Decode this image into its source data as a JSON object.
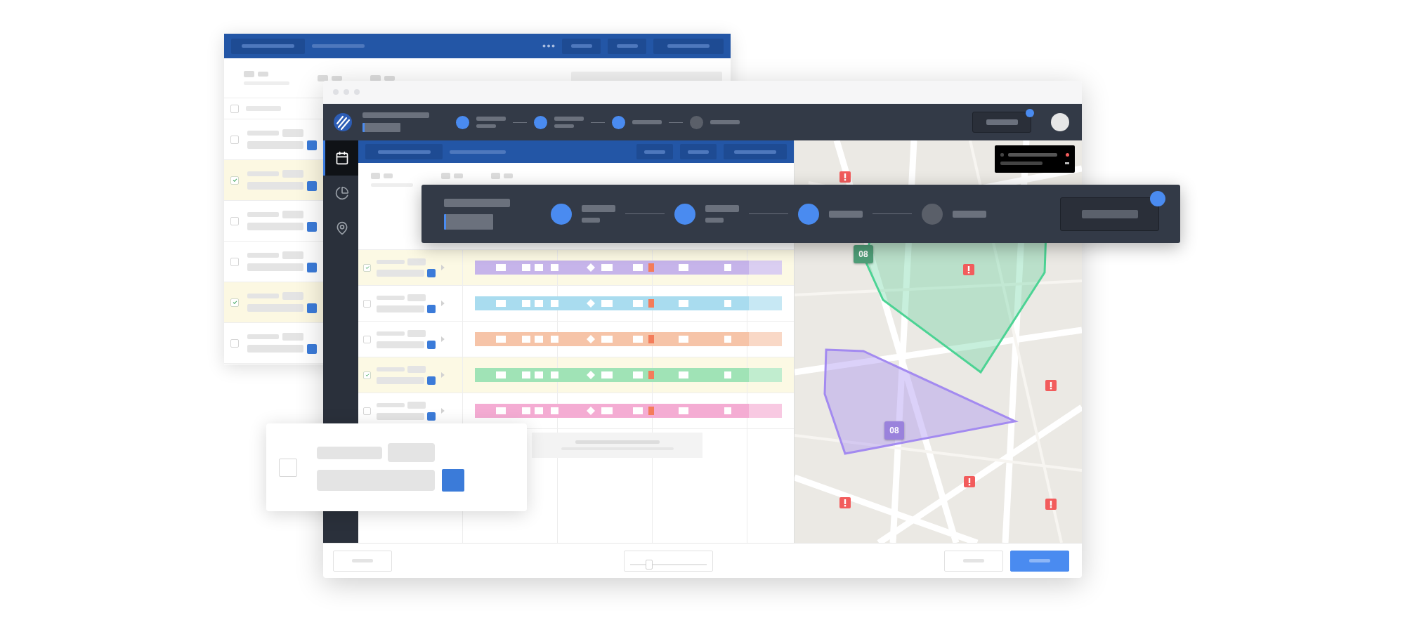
{
  "back_window": {
    "select_all": {
      "checked": false
    },
    "rows": [
      {
        "checked": false
      },
      {
        "checked": true
      },
      {
        "checked": false
      },
      {
        "checked": false
      },
      {
        "checked": true
      },
      {
        "checked": false
      }
    ]
  },
  "main_window": {
    "header_steps": [
      {
        "done": true
      },
      {
        "done": true
      },
      {
        "done": true
      },
      {
        "done": false
      }
    ],
    "sidebar": [
      {
        "selected": true
      },
      {
        "selected": false
      },
      {
        "selected": false
      }
    ],
    "rows": [
      {
        "checked": true,
        "color": "#c6b4ea"
      },
      {
        "checked": false,
        "color": "#a9dcef"
      },
      {
        "checked": false,
        "color": "#f6c4a8"
      },
      {
        "checked": true,
        "color": "#a0e3b6"
      },
      {
        "checked": false,
        "color": "#f4acd3"
      }
    ],
    "map": {
      "markers": [
        {
          "label": "08",
          "color": "#4f9e78"
        },
        {
          "label": "08",
          "color": "#9a82dc"
        }
      ]
    },
    "zoom_slider": {
      "level": 0.25
    }
  },
  "stepper_overlay": {
    "steps": [
      {
        "done": true
      },
      {
        "done": true
      },
      {
        "done": true
      },
      {
        "done": false
      }
    ]
  },
  "floating_card": {
    "checked": false
  }
}
